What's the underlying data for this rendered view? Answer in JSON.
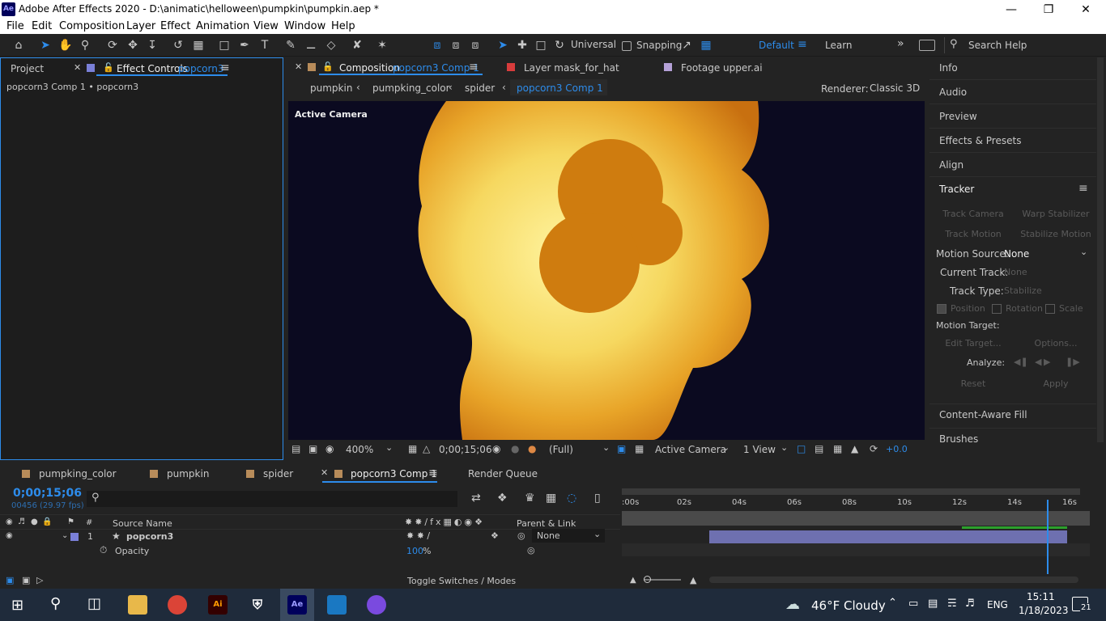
{
  "window": {
    "title": "Adobe After Effects 2020 - D:\\animatic\\helloween\\pumpkin\\pumpkin.aep *",
    "logo": "Ae"
  },
  "menu": [
    "File",
    "Edit",
    "Composition",
    "Layer",
    "Effect",
    "Animation",
    "View",
    "Window",
    "Help"
  ],
  "toolbar": {
    "universal_label": "Universal",
    "snapping_label": "Snapping",
    "workspace_default": "Default",
    "workspace_learn": "Learn",
    "search_placeholder": "Search Help"
  },
  "left_panel": {
    "tab_project": "Project",
    "tab_effect_controls": "Effect Controls",
    "effect_controls_layer": "popcorn3",
    "breadcrumb": "popcorn3 Comp 1 • popcorn3"
  },
  "viewer": {
    "tab_comp_prefix": "Composition",
    "tab_comp_name": "popcorn3 Comp 1",
    "tab_layer": "Layer  mask_for_hat",
    "tab_footage": "Footage  upper.ai",
    "nav": [
      "pumpkin",
      "pumpking_color",
      "spider",
      "popcorn3 Comp 1"
    ],
    "renderer_label": "Renderer:",
    "renderer_value": "Classic 3D",
    "active_camera_label": "Active Camera",
    "zoom": "400%",
    "timecode": "0;00;15;06",
    "resolution": "(Full)",
    "camera": "Active Camera",
    "views": "1 View",
    "exposure": "+0.0"
  },
  "right_panel": {
    "sections": [
      "Info",
      "Audio",
      "Preview",
      "Effects & Presets",
      "Align",
      "Tracker"
    ],
    "track_camera": "Track Camera",
    "warp_stabilizer": "Warp Stabilizer",
    "track_motion": "Track Motion",
    "stabilize_motion": "Stabilize Motion",
    "motion_source_label": "Motion Source:",
    "motion_source_value": "None",
    "current_track_label": "Current Track:",
    "current_track_value": "None",
    "track_type_label": "Track Type:",
    "track_type_value": "Stabilize",
    "position": "Position",
    "rotation": "Rotation",
    "scale": "Scale",
    "motion_target_label": "Motion Target:",
    "edit_target": "Edit Target...",
    "options": "Options...",
    "analyze_label": "Analyze:",
    "reset": "Reset",
    "apply": "Apply",
    "content_aware_fill": "Content-Aware Fill",
    "brushes": "Brushes"
  },
  "timeline": {
    "tabs": [
      "pumpking_color",
      "pumpkin",
      "spider",
      "popcorn3 Comp 1",
      "Render Queue"
    ],
    "timecode": "0;00;15;06",
    "frames": "00456 (29.97 fps)",
    "col_source": "Source Name",
    "col_hash": "#",
    "col_parent": "Parent & Link",
    "layer_num": "1",
    "layer_name": "popcorn3",
    "layer_parent": "None",
    "prop_name": "Opacity",
    "prop_value": "100",
    "prop_unit": "%",
    "toggle_label": "Toggle Switches / Modes",
    "ruler": [
      ":00s",
      "02s",
      "04s",
      "06s",
      "08s",
      "10s",
      "12s",
      "14s",
      "16s"
    ],
    "playhead_seconds": 15.2
  },
  "taskbar": {
    "weather": "46°F  Cloudy",
    "lang": "ENG",
    "time": "15:11",
    "date": "1/18/2023",
    "notifications": "21"
  },
  "colors": {
    "accent": "#2d8ceb",
    "comp_bg": "#0b0a20",
    "layer_bar": "#6e70b0"
  }
}
